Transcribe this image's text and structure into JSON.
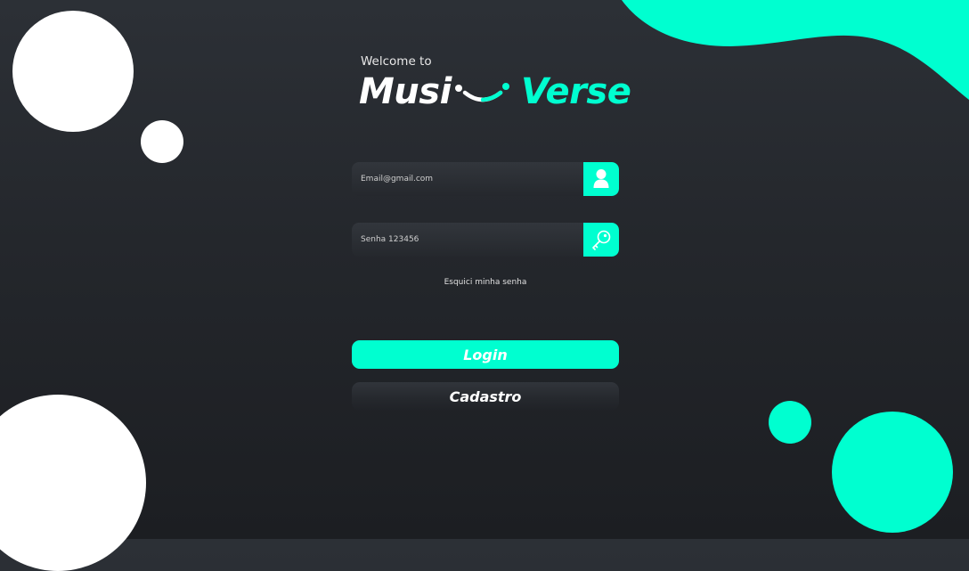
{
  "header": {
    "welcome_text": "Welcome to",
    "logo_left": "Musi",
    "logo_right": "Verse"
  },
  "form": {
    "email_placeholder": "Email@gmail.com",
    "password_placeholder": "Senha 123456",
    "forgot_password": "Esquici minha senha",
    "login_label": "Login",
    "signup_label": "Cadastro"
  },
  "icons": {
    "email_field": "user-icon",
    "password_field": "key-icon",
    "logo_mark": "smile-icon"
  },
  "colors": {
    "accent": "#00ffd0",
    "background": "#25282d",
    "white": "#ffffff"
  }
}
